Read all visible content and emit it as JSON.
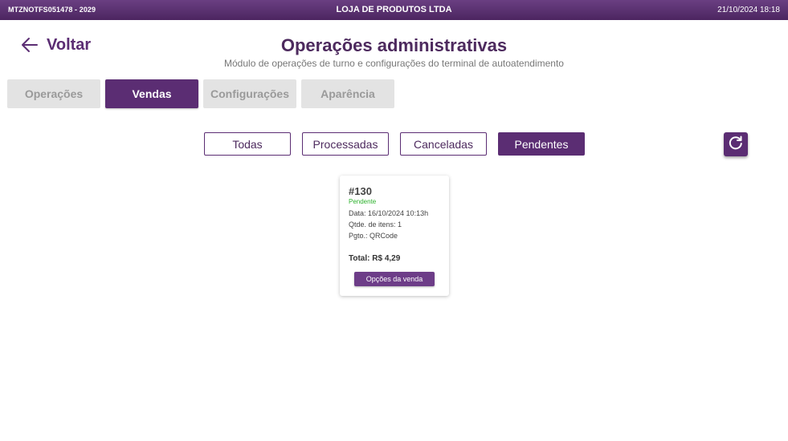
{
  "header": {
    "terminal_id": "MTZNOTFS051478 - 2029",
    "store_name": "LOJA DE PRODUTOS LTDA",
    "datetime": "21/10/2024 18:18"
  },
  "nav": {
    "back_label": "Voltar"
  },
  "page": {
    "title": "Operações administrativas",
    "subtitle": "Módulo de operações de turno e configurações do terminal de autoatendimento"
  },
  "tabs": [
    {
      "label": "Operações",
      "active": false
    },
    {
      "label": "Vendas",
      "active": true
    },
    {
      "label": "Configurações",
      "active": false
    },
    {
      "label": "Aparência",
      "active": false
    }
  ],
  "filters": [
    {
      "label": "Todas",
      "active": false
    },
    {
      "label": "Processadas",
      "active": false
    },
    {
      "label": "Canceladas",
      "active": false
    },
    {
      "label": "Pendentes",
      "active": true
    }
  ],
  "icons": {
    "back": "arrow-left-icon",
    "refresh": "refresh-icon"
  },
  "colors": {
    "brand": "#5b2d73",
    "pending_status": "#2db22d",
    "inactive_tab": "#e3e3e3"
  },
  "sales": [
    {
      "number": "#130",
      "status": "Pendente",
      "date": "Data: 16/10/2024 10:13h",
      "items": "Qtde. de itens: 1",
      "payment": "Pgto.: QRCode",
      "total": "Total: R$ 4,29",
      "options_label": "Opções da venda"
    }
  ]
}
